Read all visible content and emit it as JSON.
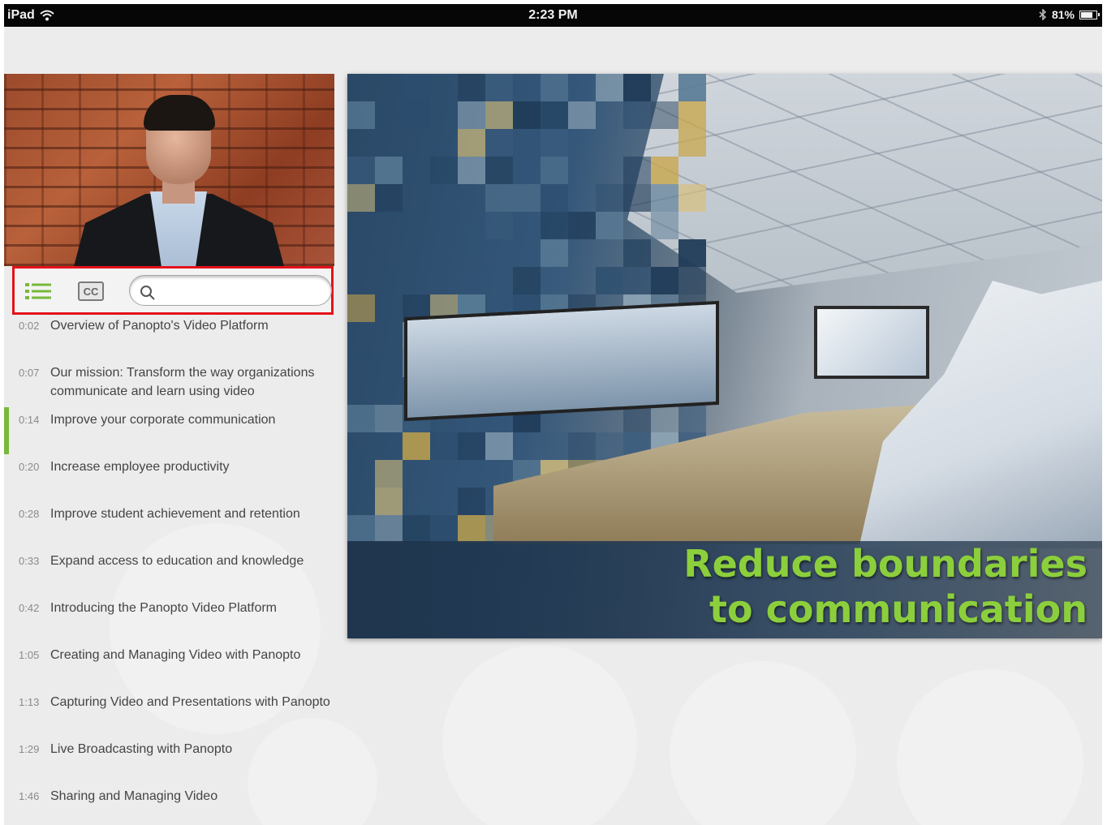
{
  "status_bar": {
    "device": "iPad",
    "time": "2:23 PM",
    "battery_percent": "81%",
    "battery_level": 0.81,
    "icons": [
      "wifi-icon",
      "bluetooth-icon",
      "battery-icon"
    ]
  },
  "toolbar": {
    "list_icon": "list-icon",
    "cc_icon": "closed-captions-icon",
    "search_placeholder": "",
    "search_value": "",
    "accent": "#78b83b",
    "highlight": "#e3121b"
  },
  "chapters": [
    {
      "time": "0:02",
      "title": "Overview of Panopto's Video Platform"
    },
    {
      "time": "0:07",
      "title": "Our mission: Transform the way organizations communicate and learn using video"
    },
    {
      "time": "0:14",
      "title": "Improve your corporate communication",
      "active": true
    },
    {
      "time": "0:20",
      "title": "Increase employee productivity"
    },
    {
      "time": "0:28",
      "title": "Improve student achievement and retention"
    },
    {
      "time": "0:33",
      "title": "Expand access to education and knowledge"
    },
    {
      "time": "0:42",
      "title": "Introducing the Panopto Video Platform"
    },
    {
      "time": "1:05",
      "title": "Creating and Managing Video with Panopto"
    },
    {
      "time": "1:13",
      "title": "Capturing Video and Presentations with Panopto"
    },
    {
      "time": "1:29",
      "title": "Live Broadcasting with Panopto"
    },
    {
      "time": "1:46",
      "title": "Sharing and Managing Video"
    }
  ],
  "slide": {
    "caption_line1": "Reduce boundaries",
    "caption_line2": "to communication",
    "caption_color": "#8ccf3c"
  }
}
